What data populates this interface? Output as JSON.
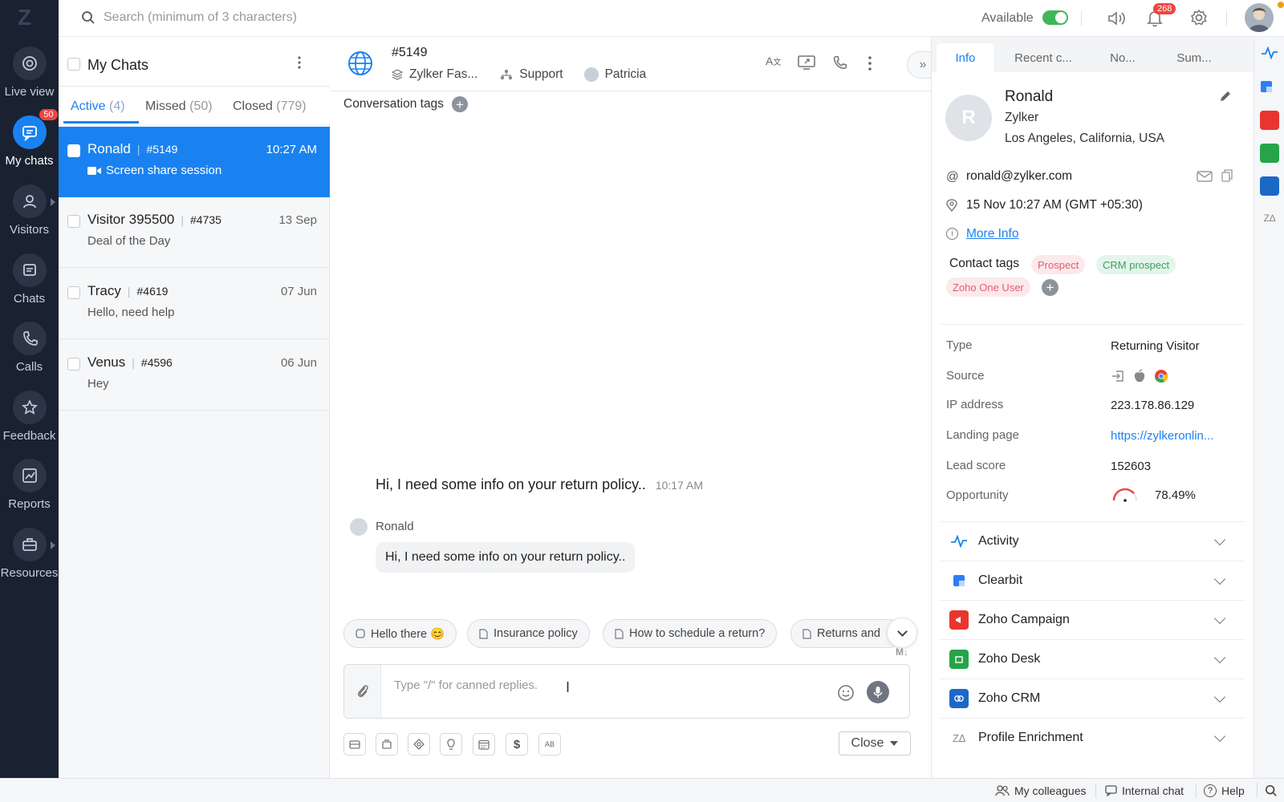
{
  "nav": {
    "items": [
      {
        "label": "Live view"
      },
      {
        "label": "My chats",
        "badge": "50"
      },
      {
        "label": "Visitors"
      },
      {
        "label": "Chats"
      },
      {
        "label": "Calls"
      },
      {
        "label": "Feedback"
      },
      {
        "label": "Reports"
      },
      {
        "label": "Resources"
      }
    ]
  },
  "topbar": {
    "search_placeholder": "Search (minimum of 3 characters)",
    "status": "Available",
    "notifications": "268"
  },
  "chatlist": {
    "title": "My Chats",
    "tabs": [
      {
        "label": "Active",
        "count": "(4)"
      },
      {
        "label": "Missed",
        "count": "(50)"
      },
      {
        "label": "Closed",
        "count": "(779)"
      }
    ],
    "chats": [
      {
        "name": "Ronald",
        "id": "#5149",
        "time": "10:27 AM",
        "msg": "Screen share session"
      },
      {
        "name": "Visitor 395500",
        "id": "#4735",
        "time": "13 Sep",
        "msg": "Deal of the Day"
      },
      {
        "name": "Tracy",
        "id": "#4619",
        "time": "07 Jun",
        "msg": "Hello, need help"
      },
      {
        "name": "Venus",
        "id": "#4596",
        "time": "06 Jun",
        "msg": "Hey"
      }
    ]
  },
  "conversation": {
    "chat_id": "#5149",
    "brand": "Zylker Fas...",
    "department": "Support",
    "agent": "Patricia",
    "tags_label": "Conversation tags",
    "question": "Hi, I need some info on your return policy..",
    "question_time": "10:17 AM",
    "sender": "Ronald",
    "bubble": "Hi, I need some info on your return policy..",
    "suggestions": [
      "Hello there 😊",
      "Insurance policy",
      "How to schedule a return?",
      "Returns and"
    ],
    "md_label": "M↓",
    "input_placeholder": "Type \"/\" for canned replies.",
    "close_label": "Close"
  },
  "info": {
    "tabs": [
      "Info",
      "Recent c...",
      "No...",
      "Sum..."
    ],
    "name": "Ronald",
    "company": "Zylker",
    "location": "Los Angeles, California, USA",
    "email": "ronald@zylker.com",
    "datetime": "15 Nov 10:27 AM",
    "timezone": "(GMT +05:30)",
    "more_info": "More Info",
    "contact_tags_label": "Contact tags",
    "tags": [
      "Prospect",
      "CRM prospect",
      "Zoho One User"
    ],
    "fields": [
      {
        "label": "Type",
        "value": "Returning Visitor"
      },
      {
        "label": "Source",
        "value": ""
      },
      {
        "label": "IP address",
        "value": "223.178.86.129"
      },
      {
        "label": "Landing page",
        "value": "https://zylkeronlin..."
      },
      {
        "label": "Lead score",
        "value": "152603"
      },
      {
        "label": "Opportunity",
        "value": "78.49%"
      }
    ],
    "opportunity_fraction": 0.7849,
    "sections": [
      "Activity",
      "Clearbit",
      "Zoho Campaign",
      "Zoho Desk",
      "Zoho CRM",
      "Profile Enrichment"
    ]
  },
  "bottombar": {
    "colleagues": "My colleagues",
    "internal_chat": "Internal chat",
    "help": "Help"
  },
  "colors": {
    "accent": "#1a82f0",
    "nav_bg": "#1a2231",
    "badge": "#f0443f",
    "online": "#3fb65a"
  }
}
